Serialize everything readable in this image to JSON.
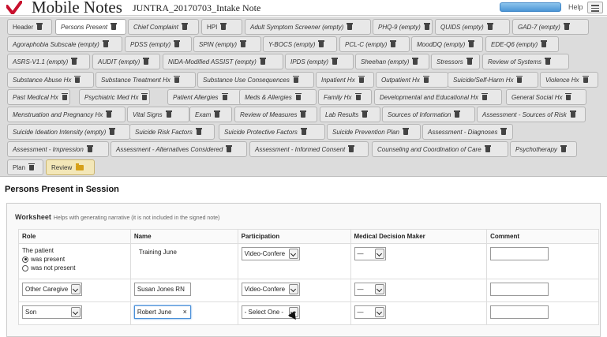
{
  "header": {
    "app_title": "Mobile Notes",
    "doc_title": "JUNTRA_20170703_Intake Note",
    "help_label": "Help",
    "colors": {
      "accent": "#4c96d6",
      "logo": "#c8102e"
    }
  },
  "tabs": [
    {
      "label": "Header",
      "icon": "trash-icon"
    },
    {
      "label": "Persons Present",
      "icon": "trash-icon",
      "active": true
    },
    {
      "label": "Chief Complaint",
      "icon": "trash-icon"
    },
    {
      "label": "HPI",
      "icon": "trash-icon"
    },
    {
      "label": "Adult Symptom Screener (empty)",
      "icon": "trash-icon"
    },
    {
      "label": "PHQ-9 (empty)",
      "icon": "trash-icon"
    },
    {
      "label": "QUIDS (empty)",
      "icon": "trash-icon"
    },
    {
      "label": "GAD-7 (empty)",
      "icon": "trash-icon"
    },
    {
      "label": "Agoraphobia Subscale (empty)",
      "icon": "trash-icon"
    },
    {
      "label": "PDSS (empty)",
      "icon": "trash-icon"
    },
    {
      "label": "SPIN (empty)",
      "icon": "trash-icon"
    },
    {
      "label": "Y-BOCS (empty)",
      "icon": "trash-icon"
    },
    {
      "label": "PCL-C (empty)",
      "icon": "trash-icon"
    },
    {
      "label": "MoodDQ (empty)",
      "icon": "trash-icon"
    },
    {
      "label": "EDE-Q6 (empty)",
      "icon": "trash-icon"
    },
    {
      "label": "ASRS-V1.1 (empty)",
      "icon": "trash-icon"
    },
    {
      "label": "AUDIT (empty)",
      "icon": "trash-icon"
    },
    {
      "label": "NIDA-Modified ASSIST (empty)",
      "icon": "trash-icon"
    },
    {
      "label": "IPDS (empty)",
      "icon": "trash-icon"
    },
    {
      "label": "Sheehan (empty)",
      "icon": "trash-icon"
    },
    {
      "label": "Stressors",
      "icon": "trash-icon"
    },
    {
      "label": "Review of Systems",
      "icon": "trash-icon"
    },
    {
      "label": "Substance Abuse Hx",
      "icon": "trash-icon"
    },
    {
      "label": "Substance Treatment Hx",
      "icon": "trash-icon"
    },
    {
      "label": "Substance Use Consequences",
      "icon": "trash-icon"
    },
    {
      "label": "Inpatient Hx",
      "icon": "trash-icon"
    },
    {
      "label": "Outpatient Hx",
      "icon": "trash-icon"
    },
    {
      "label": "Suicide/Self-Harm Hx",
      "icon": "trash-icon"
    },
    {
      "label": "Violence Hx",
      "icon": "trash-icon"
    },
    {
      "label": "Past Medical Hx",
      "icon": "trash-icon"
    },
    {
      "label": "Psychiatric Med Hx",
      "icon": "trash-icon"
    },
    {
      "label": "Patient Allergies",
      "icon": "trash-icon"
    },
    {
      "label": "Meds & Allergies",
      "icon": "trash-icon"
    },
    {
      "label": "Family Hx",
      "icon": "trash-icon"
    },
    {
      "label": "Developmental and Educational Hx",
      "icon": "trash-icon"
    },
    {
      "label": "General Social Hx",
      "icon": "trash-icon"
    },
    {
      "label": "Menstruation and Pregnancy Hx",
      "icon": "trash-icon"
    },
    {
      "label": "Vital Signs",
      "icon": "trash-icon"
    },
    {
      "label": "Exam",
      "icon": "trash-icon"
    },
    {
      "label": "Review of Measures",
      "icon": "trash-icon"
    },
    {
      "label": "Lab Results",
      "icon": "trash-icon"
    },
    {
      "label": "Sources of Information",
      "icon": "trash-icon"
    },
    {
      "label": "Assessment - Sources of Risk",
      "icon": "trash-icon"
    },
    {
      "label": "Suicide Ideation Intensity (empty)",
      "icon": "trash-icon"
    },
    {
      "label": "Suicide Risk Factors",
      "icon": "trash-icon"
    },
    {
      "label": "Suicide Protective Factors",
      "icon": "trash-icon"
    },
    {
      "label": "Suicide Prevention Plan",
      "icon": "trash-icon"
    },
    {
      "label": "Assessment - Diagnoses",
      "icon": "trash-icon"
    },
    {
      "label": "Assessment - Impression",
      "icon": "trash-icon"
    },
    {
      "label": "Assessment - Alternatives Considered",
      "icon": "trash-icon"
    },
    {
      "label": "Assessment - Informed Consent",
      "icon": "trash-icon"
    },
    {
      "label": "Counseling and Coordination of Care",
      "icon": "trash-icon"
    },
    {
      "label": "Psychotherapy",
      "icon": "trash-icon"
    },
    {
      "label": "Plan",
      "icon": "trash-icon"
    },
    {
      "label": "Review",
      "icon": "folder-icon"
    }
  ],
  "section": {
    "title": "Persons Present in Session"
  },
  "worksheet": {
    "title": "Worksheet",
    "subtitle": "Helps with generating narrative (it is not included in the signed note)",
    "columns": [
      "Role",
      "Name",
      "Participation",
      "Medical Decision Maker",
      "Comment"
    ],
    "rows": [
      {
        "role_label": "The patient",
        "radio_present": "was present",
        "radio_not_present": "was not present",
        "name": "Training June",
        "participation": "Video-Confere",
        "mdm": "—",
        "comment": ""
      },
      {
        "role": "Other Caregive",
        "name": "Susan Jones RN",
        "participation": "Video-Confere",
        "mdm": "—",
        "comment": ""
      },
      {
        "role": "Son",
        "name": "Robert June",
        "name_clear": "×",
        "participation": "- Select One -",
        "mdm": "—",
        "comment": ""
      }
    ]
  }
}
